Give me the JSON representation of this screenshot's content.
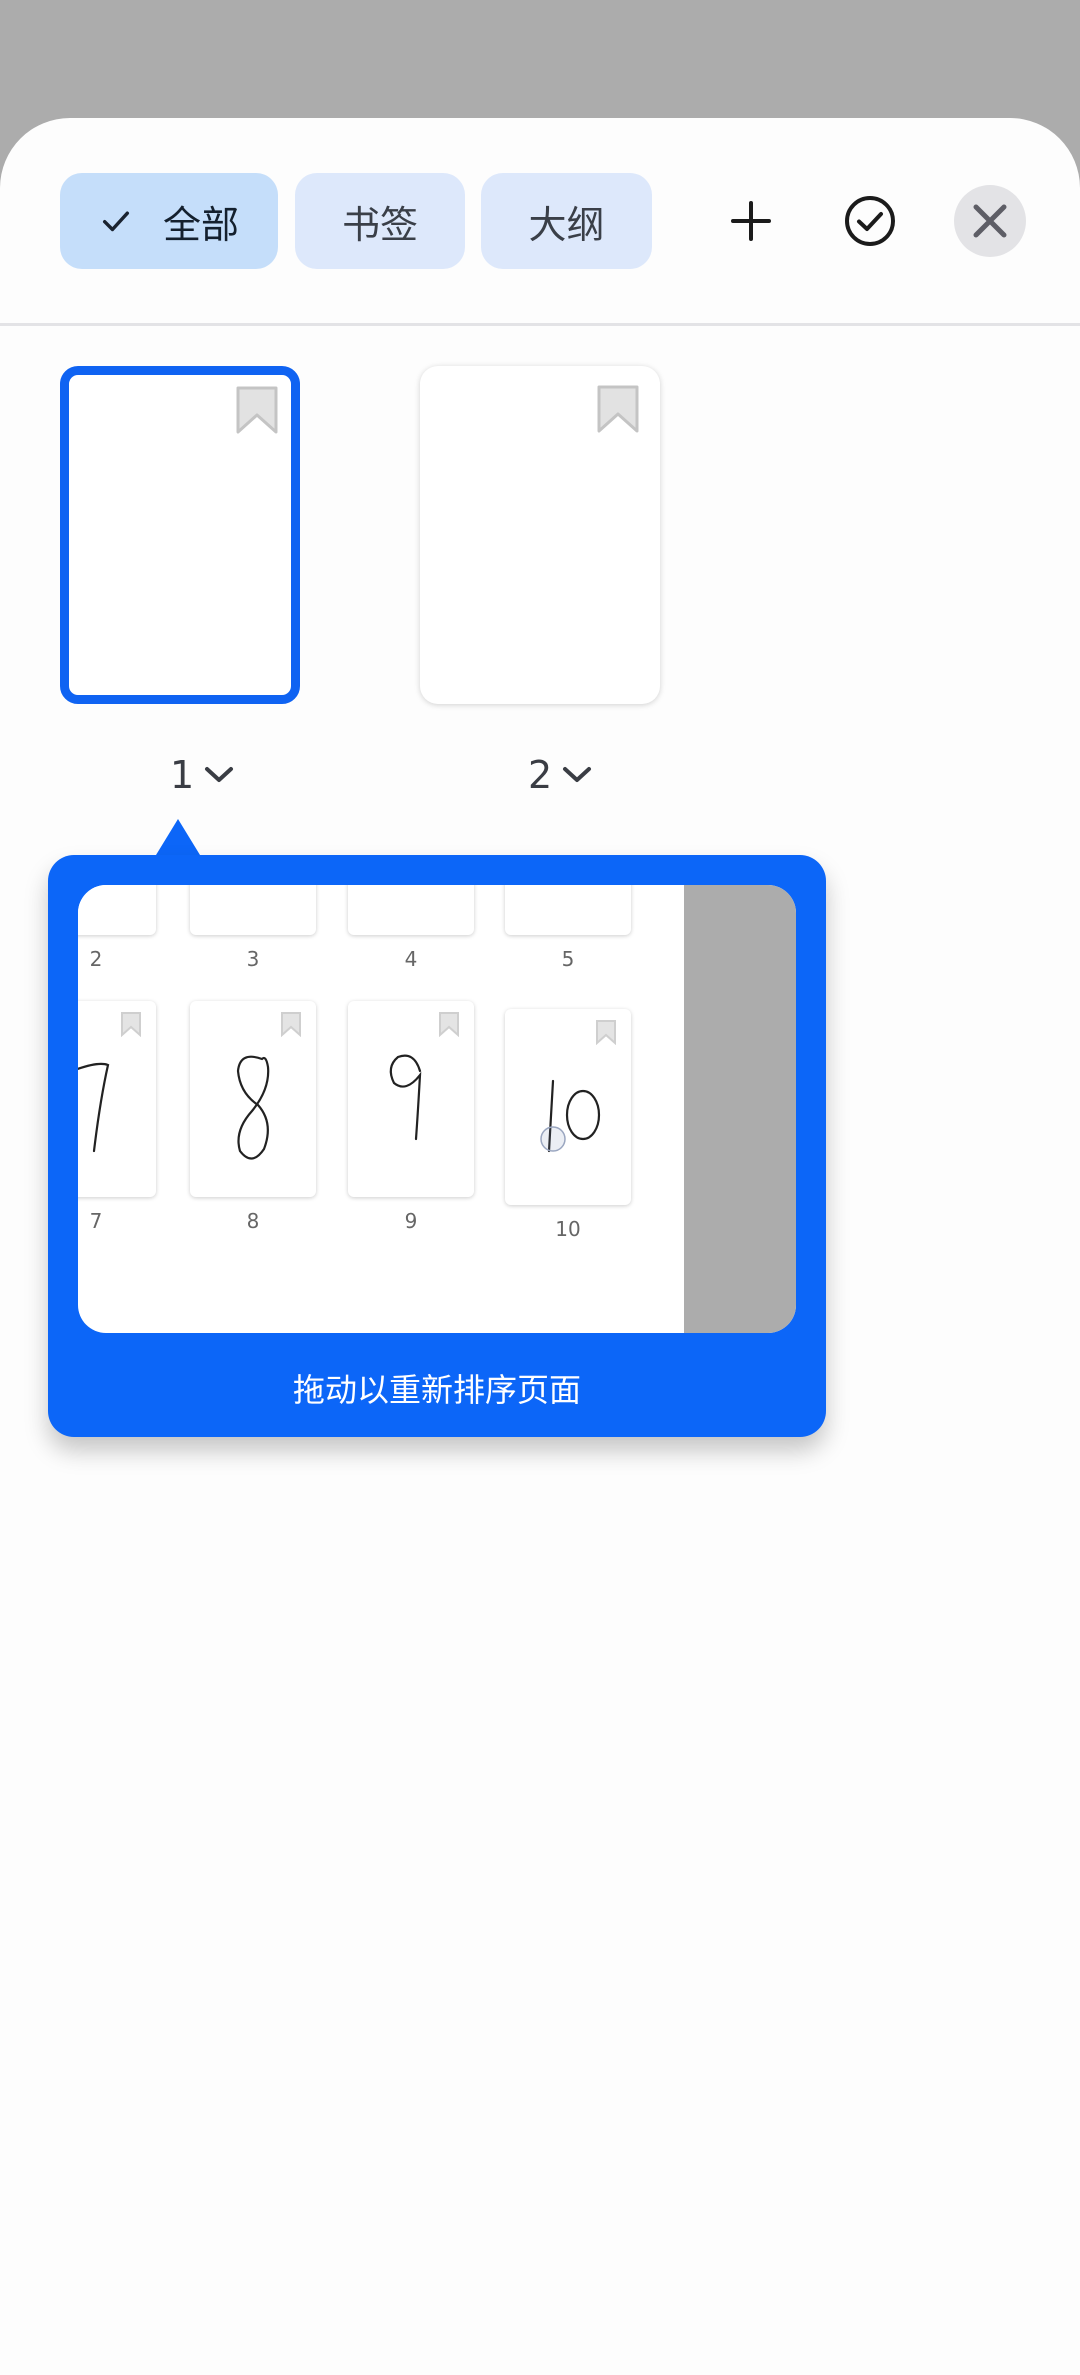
{
  "filters": {
    "all_label": "全部",
    "bookmarks_label": "书签",
    "outline_label": "大纲"
  },
  "pages": [
    {
      "number": "1",
      "selected": true
    },
    {
      "number": "2",
      "selected": false
    }
  ],
  "tooltip": {
    "text": "拖动以重新排序页面",
    "preview_labels": [
      "2",
      "3",
      "4",
      "5",
      "7",
      "8",
      "9",
      "10"
    ]
  },
  "colors": {
    "accent": "#0c66f8",
    "chip_selected": "#c5defa",
    "chip": "#dde8fb"
  }
}
